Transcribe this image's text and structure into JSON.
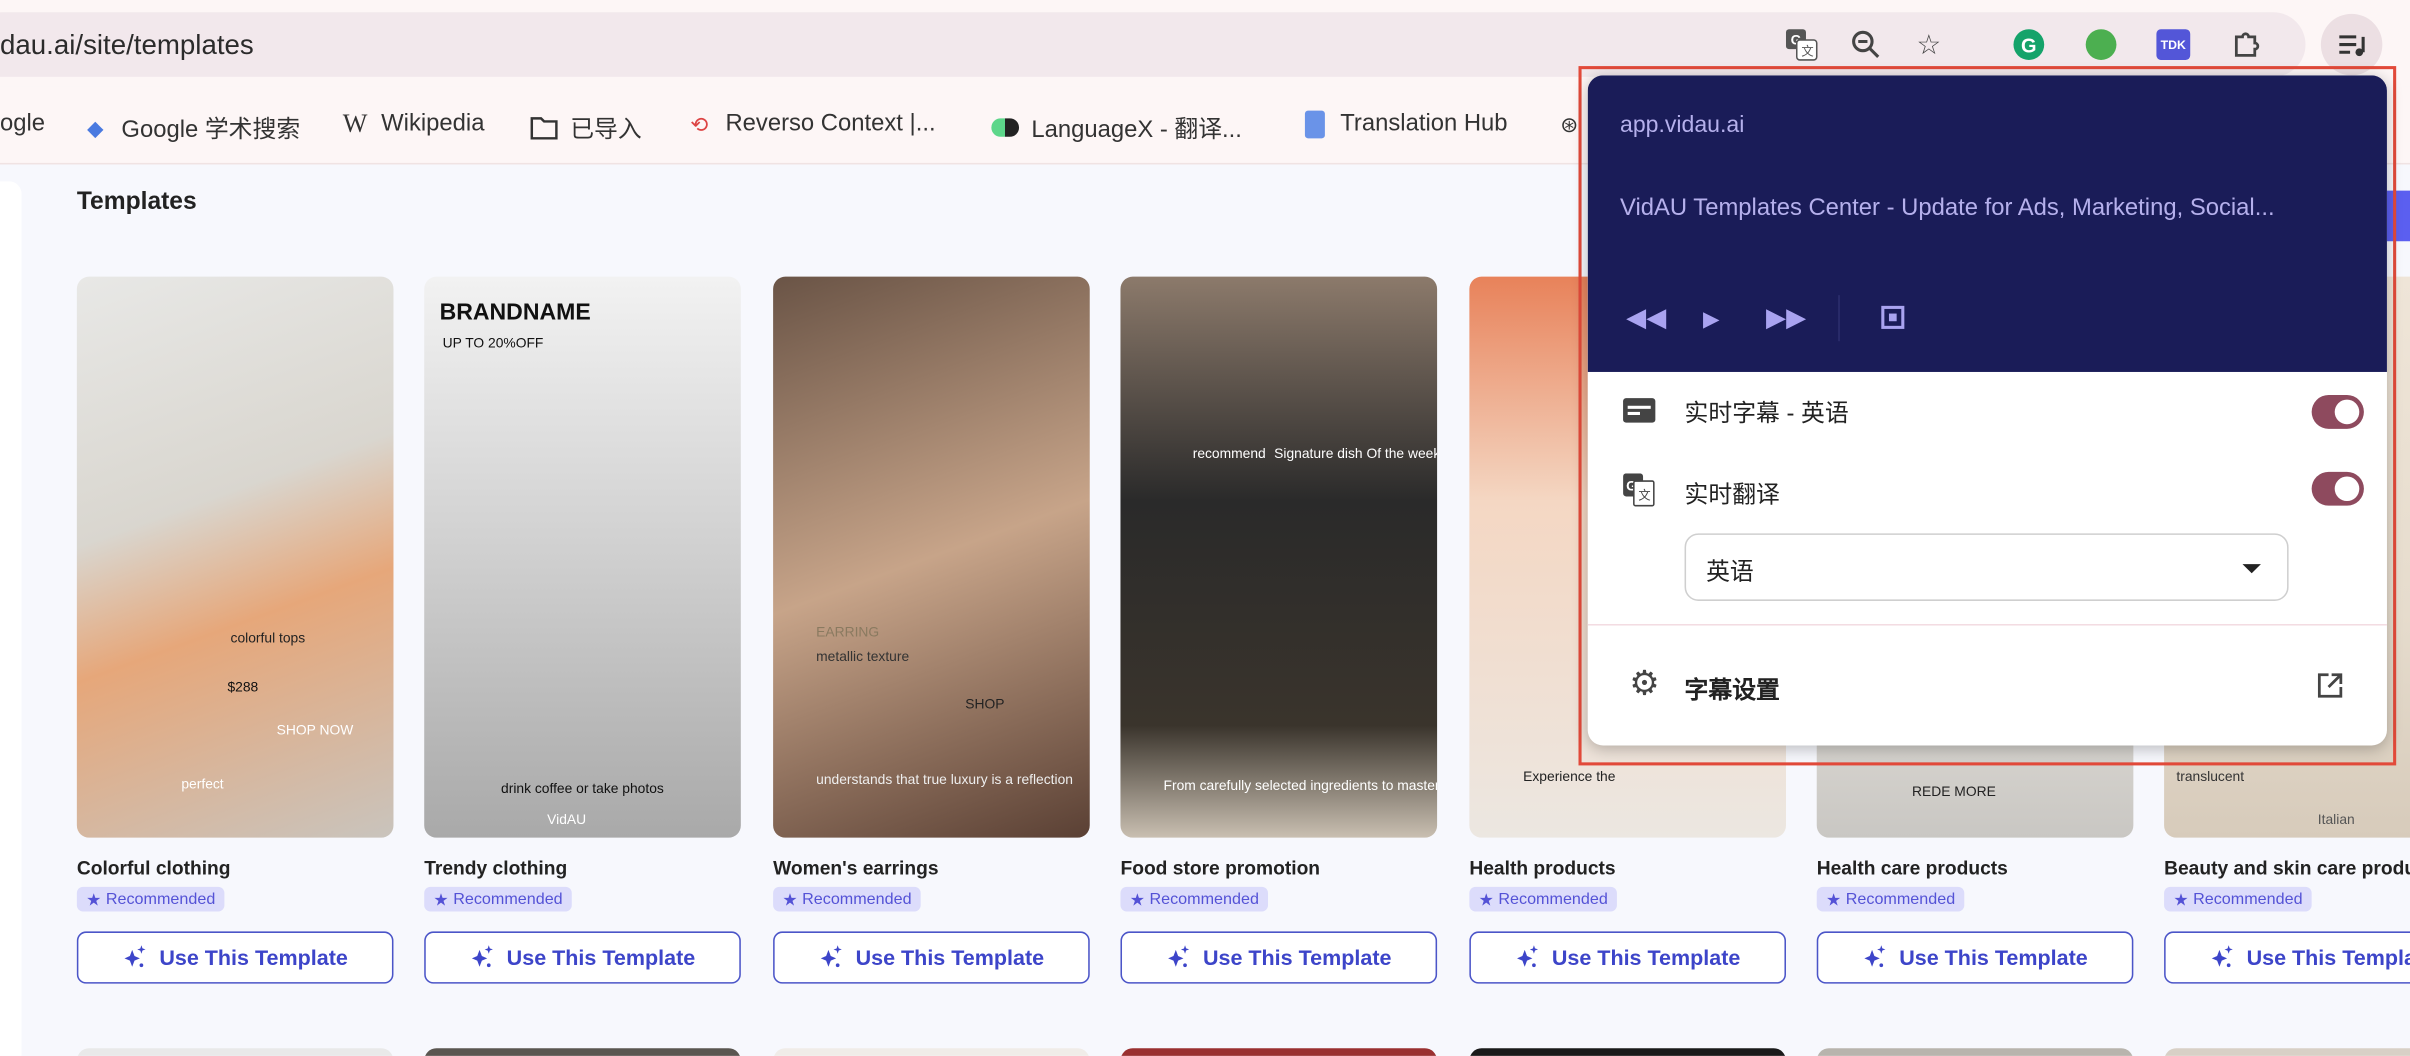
{
  "browser": {
    "url": "dau.ai/site/templates",
    "toolbar_icons": [
      "translate-icon",
      "zoom-icon",
      "star-icon",
      "grammarly-icon",
      "robot-extension-icon",
      "tdk-extension-icon",
      "puzzle-icon",
      "media-control-icon"
    ],
    "tdk_label": "TDK",
    "bookmarks": [
      {
        "label": "ogle",
        "icon": "google"
      },
      {
        "label": "Google 学术搜索",
        "icon": "scholar"
      },
      {
        "label": "Wikipedia",
        "icon": "wikipedia"
      },
      {
        "label": "已导入",
        "icon": "folder"
      },
      {
        "label": "Reverso Context |...",
        "icon": "reverso"
      },
      {
        "label": "LanguageX - 翻译...",
        "icon": "languagex"
      },
      {
        "label": "Translation Hub",
        "icon": "translation-hub"
      }
    ]
  },
  "page": {
    "title": "Templates",
    "badge_label": "Recommended",
    "use_label": "Use This Template",
    "accent": "#3d45c9",
    "cards": [
      {
        "title": "Colorful clothing",
        "texts": [
          "colorful tops",
          "$288",
          "SHOP NOW",
          "perfect"
        ]
      },
      {
        "title": "Trendy clothing",
        "texts": [
          "BRANDNAME",
          "UP TO 20%OFF",
          "drink coffee or take photos",
          "VidAU"
        ]
      },
      {
        "title": "Women's earrings",
        "texts": [
          "EARRING",
          "metallic texture",
          "SHOP",
          "understands that true luxury is a reflection"
        ]
      },
      {
        "title": "Food store promotion",
        "texts": [
          "recommend",
          "Signature dish Of the week",
          "From carefully selected ingredients to masterful culinary"
        ]
      },
      {
        "title": "Health products",
        "texts": [
          "Experience the"
        ]
      },
      {
        "title": "Health care products",
        "texts": [
          "REDE MORE"
        ]
      },
      {
        "title": "Beauty and skin care produ",
        "texts": [
          "translucent",
          "Italian"
        ]
      }
    ]
  },
  "popup": {
    "host": "app.vidau.ai",
    "media_title": "VidAU Templates Center - Update for Ads, Marketing, Social...",
    "captions_label": "实时字幕 - 英语",
    "captions_on": true,
    "translate_label": "实时翻译",
    "translate_on": true,
    "language_value": "英语",
    "settings_label": "字幕设置",
    "header_color": "#1a1c58",
    "toggle_color": "#8e4a5e"
  }
}
